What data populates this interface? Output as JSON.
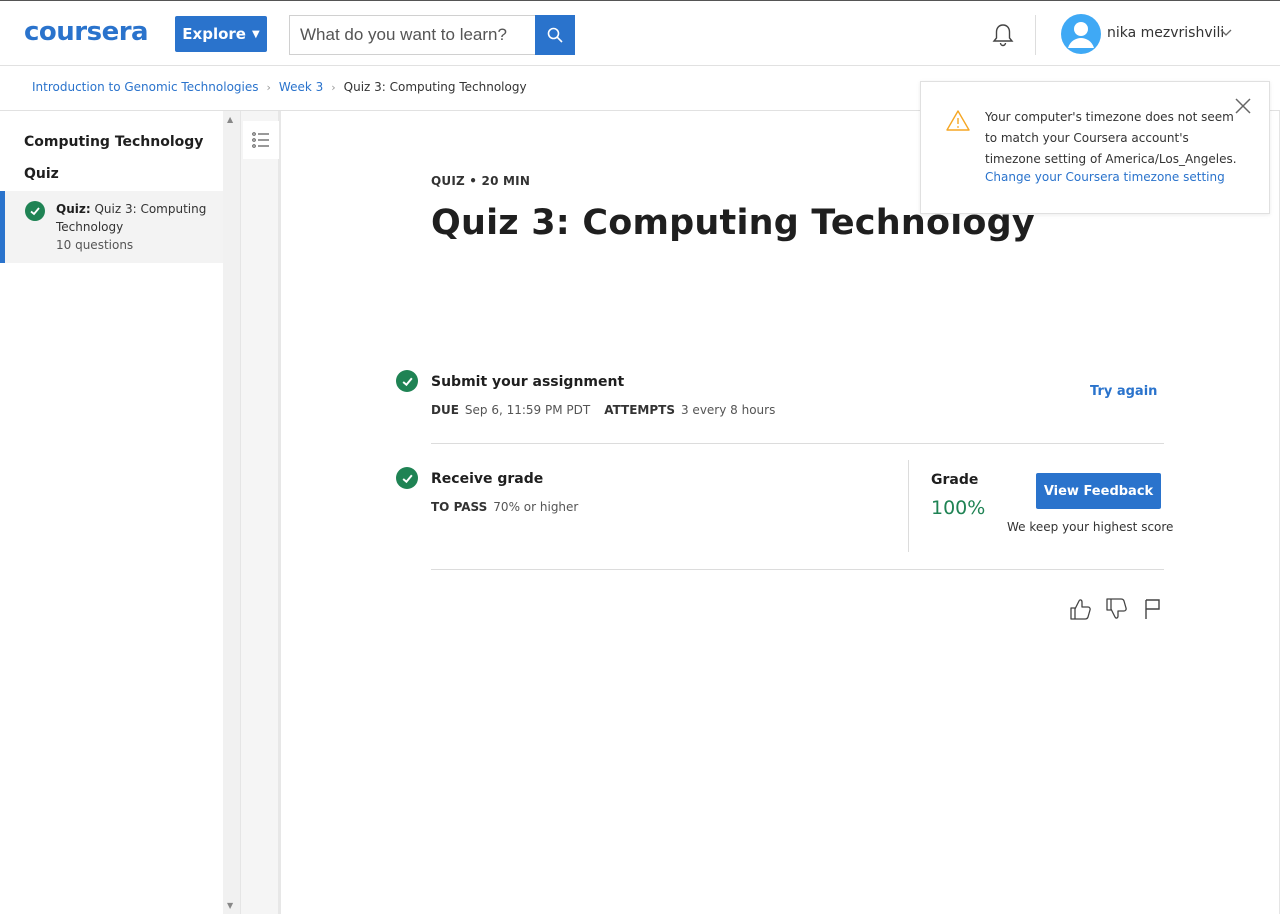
{
  "header": {
    "logo": "coursera",
    "explore_label": "Explore",
    "search_placeholder": "What do you want to learn?",
    "username": "nika mezvrishvili"
  },
  "breadcrumb": {
    "course": "Introduction to Genomic Technologies",
    "week": "Week 3",
    "current": "Quiz 3: Computing Technology"
  },
  "sidebar": {
    "section_title": "Computing Technology",
    "section_sub": "Quiz",
    "item_prefix": "Quiz:",
    "item_title": "Quiz 3: Computing Technology",
    "item_meta": "10 questions"
  },
  "main": {
    "meta": "QUIZ • 20 MIN",
    "title": "Quiz 3: Computing Technology",
    "submit": {
      "title": "Submit your assignment",
      "due_label": "DUE",
      "due_value": "Sep 6, 11:59 PM PDT",
      "attempts_label": "ATTEMPTS",
      "attempts_value": "3 every 8 hours",
      "try_again": "Try again"
    },
    "receive": {
      "title": "Receive grade",
      "pass_label": "TO PASS",
      "pass_value": "70% or higher",
      "grade_label": "Grade",
      "grade_value": "100%",
      "feedback_button": "View Feedback",
      "note": "We keep your highest score"
    }
  },
  "toast": {
    "message": "Your computer's timezone does not seem to match your Coursera account's timezone setting of America/Los_Angeles.",
    "link": "Change your Coursera timezone setting"
  },
  "colors": {
    "brand_blue": "#2a73cc",
    "success_green": "#1f8354",
    "warning_orange": "#f5a623"
  },
  "icons": [
    "search-icon",
    "bell-icon",
    "avatar-icon",
    "chevron-down-icon",
    "check-icon",
    "list-icon",
    "thumbs-up-icon",
    "thumbs-down-icon",
    "flag-icon",
    "warning-icon",
    "close-icon"
  ]
}
